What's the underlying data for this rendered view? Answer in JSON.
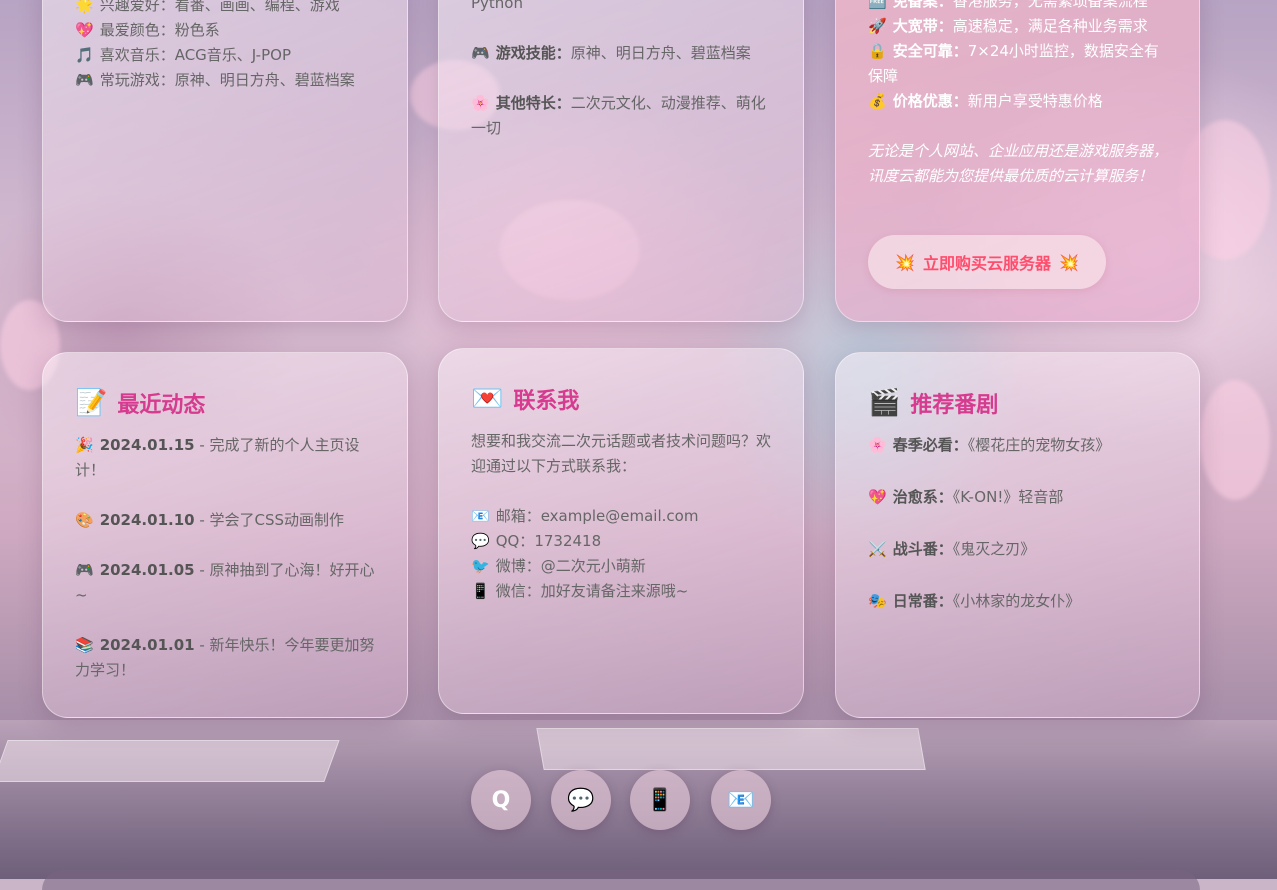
{
  "hobbies_card": {
    "line1_icon": "🌟",
    "line1_label": "兴趣爱好：",
    "line1_value": "看番、画画、编程、游戏",
    "line2_icon": "💖",
    "line2_label": "最爱颜色：",
    "line2_value": "粉色系",
    "line3_icon": "🎵",
    "line3_label": "喜欢音乐：",
    "line3_value": "ACG音乐、J-POP",
    "line4_icon": "🎮",
    "line4_label": "常玩游戏：",
    "line4_value": "原神、明日方舟、碧蓝档案"
  },
  "skills_card": {
    "partial_text": "Python",
    "game_icon": "🎮",
    "game_label": "游戏技能：",
    "game_value": "原神、明日方舟、碧蓝档案",
    "other_icon": "🌸",
    "other_label": "其他特长：",
    "other_value": "二次元文化、动漫推荐、萌化一切"
  },
  "cloud_card": {
    "line0_icon": "🆓",
    "line0_label": "免备案：",
    "line0_value": "香港服务，无需繁琐备案流程",
    "line1_icon": "🚀",
    "line1_label": "大宽带：",
    "line1_value": "高速稳定，满足各种业务需求",
    "line2_icon": "🔒",
    "line2_label": "安全可靠：",
    "line2_value": "7×24小时监控，数据安全有保障",
    "line3_icon": "💰",
    "line3_label": "价格优惠：",
    "line3_value": "新用户享受特惠价格",
    "slogan": "无论是个人网站、企业应用还是游戏服务器，讯度云都能为您提供最优质的云计算服务！",
    "buy_icon": "💥",
    "buy_label": "立即购买云服务器"
  },
  "recent_card": {
    "icon": "📝",
    "title": "最近动态",
    "items": [
      {
        "icon": "🎉",
        "date": "2024.01.15",
        "text": " - 完成了新的个人主页设计！"
      },
      {
        "icon": "🎨",
        "date": "2024.01.10",
        "text": " - 学会了CSS动画制作"
      },
      {
        "icon": "🎮",
        "date": "2024.01.05",
        "text": " - 原神抽到了心海！好开心~"
      },
      {
        "icon": "📚",
        "date": "2024.01.01",
        "text": " - 新年快乐！今年要更加努力学习！"
      }
    ]
  },
  "contact_card": {
    "icon": "💌",
    "title": "联系我",
    "intro": "想要和我交流二次元话题或者技术问题吗？欢迎通过以下方式联系我：",
    "items": [
      {
        "icon": "📧",
        "label": "邮箱：",
        "value": "example@email.com"
      },
      {
        "icon": "💬",
        "label": "QQ：",
        "value": "1732418"
      },
      {
        "icon": "🐦",
        "label": "微博：",
        "value": "@二次元小萌新"
      },
      {
        "icon": "📱",
        "label": "微信：",
        "value": "加好友请备注来源哦~"
      }
    ]
  },
  "anime_card": {
    "icon": "🎬",
    "title": "推荐番剧",
    "items": [
      {
        "icon": "🌸",
        "label": "春季必看：",
        "value": "《樱花庄的宠物女孩》"
      },
      {
        "icon": "💖",
        "label": "治愈系：",
        "value": "《K-ON!》轻音部"
      },
      {
        "icon": "⚔️",
        "label": "战斗番：",
        "value": "《鬼灭之刃》"
      },
      {
        "icon": "🎭",
        "label": "日常番：",
        "value": "《小林家的龙女仆》"
      }
    ]
  },
  "fab_buttons": [
    {
      "icon": "search-icon",
      "glyph": "Q"
    },
    {
      "icon": "chat-icon",
      "glyph": "💬"
    },
    {
      "icon": "phone-icon",
      "glyph": "📱"
    },
    {
      "icon": "email-icon",
      "glyph": "📧"
    }
  ],
  "colors": {
    "accent": "#d63b8f",
    "buy_button_text": "#ff4d6d"
  }
}
